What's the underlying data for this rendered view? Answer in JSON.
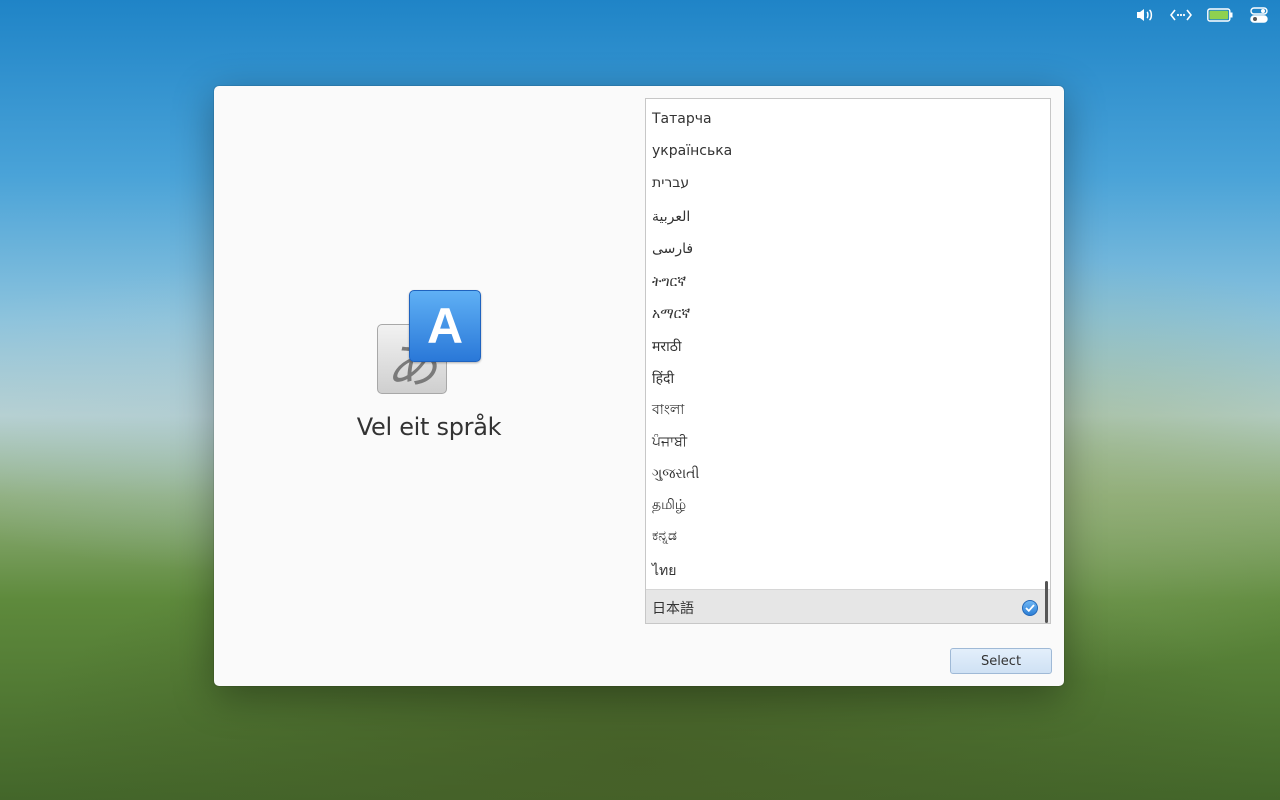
{
  "tray": {
    "icons": [
      "volume-icon",
      "network-icon",
      "battery-icon",
      "settings-toggle-icon"
    ]
  },
  "dialog": {
    "title": "Vel eit språk",
    "illustration": {
      "back_glyph": "あ",
      "front_glyph": "A"
    },
    "languages": [
      {
        "label": "Татарча"
      },
      {
        "label": "українська"
      },
      {
        "label": "עברית"
      },
      {
        "label": "العربية"
      },
      {
        "label": "فارسی"
      },
      {
        "label": "ትግርኛ"
      },
      {
        "label": "አማርኛ"
      },
      {
        "label": "मराठी"
      },
      {
        "label": "हिंदी"
      },
      {
        "label": "বাংলা"
      },
      {
        "label": "ਪੰਜਾਬੀ"
      },
      {
        "label": "ગુજરાતી"
      },
      {
        "label": "தமிழ்"
      },
      {
        "label": "ಕನ್ನಡ"
      },
      {
        "label": "ไทย"
      },
      {
        "label": "日本語",
        "selected": true
      }
    ],
    "select_label": "Select"
  },
  "colors": {
    "accent": "#2d7fd6",
    "selected_row": "#e6e6e6"
  }
}
